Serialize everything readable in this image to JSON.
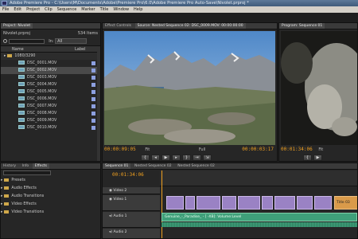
{
  "window": {
    "title": "Adobe Premiere Pro - C:\\Users\\M\\Documents\\Adobe\\Premiere Pro\\6.0\\Adobe Premiere Pro Auto-Save\\Nivolet.prproj *"
  },
  "menu": [
    "File",
    "Edit",
    "Project",
    "Clip",
    "Sequence",
    "Marker",
    "Title",
    "Window",
    "Help"
  ],
  "project": {
    "tab": "Project: Nivolet",
    "file": "Nivolet.prproj",
    "item_count": "534 Items",
    "in_label": "In:",
    "in_value": "All",
    "col_name": "Name",
    "col_label": "Label",
    "folder": "1080/3290",
    "items": [
      "DSC_0001.MOV",
      "DSC_0002.MOV",
      "DSC_0003.MOV",
      "DSC_0004.MOV",
      "DSC_0005.MOV",
      "DSC_0006.MOV",
      "DSC_0007.MOV",
      "DSC_0008.MOV",
      "DSC_0009.MOV",
      "DSC_0010.MOV"
    ]
  },
  "source": {
    "tabs": [
      "Effect Controls",
      "Source: Nested Sequence 02: DSC_0009.MOV: 00:00:00:00"
    ],
    "timecode": "00:00:09:05",
    "fit": "Fit",
    "quality": "Full",
    "duration": "00:00:03:17"
  },
  "program": {
    "tab": "Program: Sequence 01",
    "timecode": "00:01:34:06",
    "fit": "Fit"
  },
  "effects": {
    "tabs": [
      "History",
      "Info",
      "Effects"
    ],
    "items": [
      "Presets",
      "Audio Effects",
      "Audio Transitions",
      "Video Effects",
      "Video Transitions"
    ]
  },
  "timeline": {
    "tabs": [
      "Sequence 01",
      "Nested Sequence 02",
      "Nested Sequence 02"
    ],
    "timecode": "00:01:34:06",
    "tracks": {
      "video2": "Video 2",
      "video1": "Video 1",
      "audio1": "Audio 1",
      "audio2": "Audio 2"
    },
    "audio_clip_label": "Genuine_-_Paradise_ - [ -XB]: Volume:Level",
    "title_clip": "Title 03"
  },
  "colors": {
    "accent_timecode": "#f0a020",
    "video_clip": "#9a82c4",
    "audio_clip": "#3fa07a",
    "label_swatch": "#8da0e0"
  }
}
